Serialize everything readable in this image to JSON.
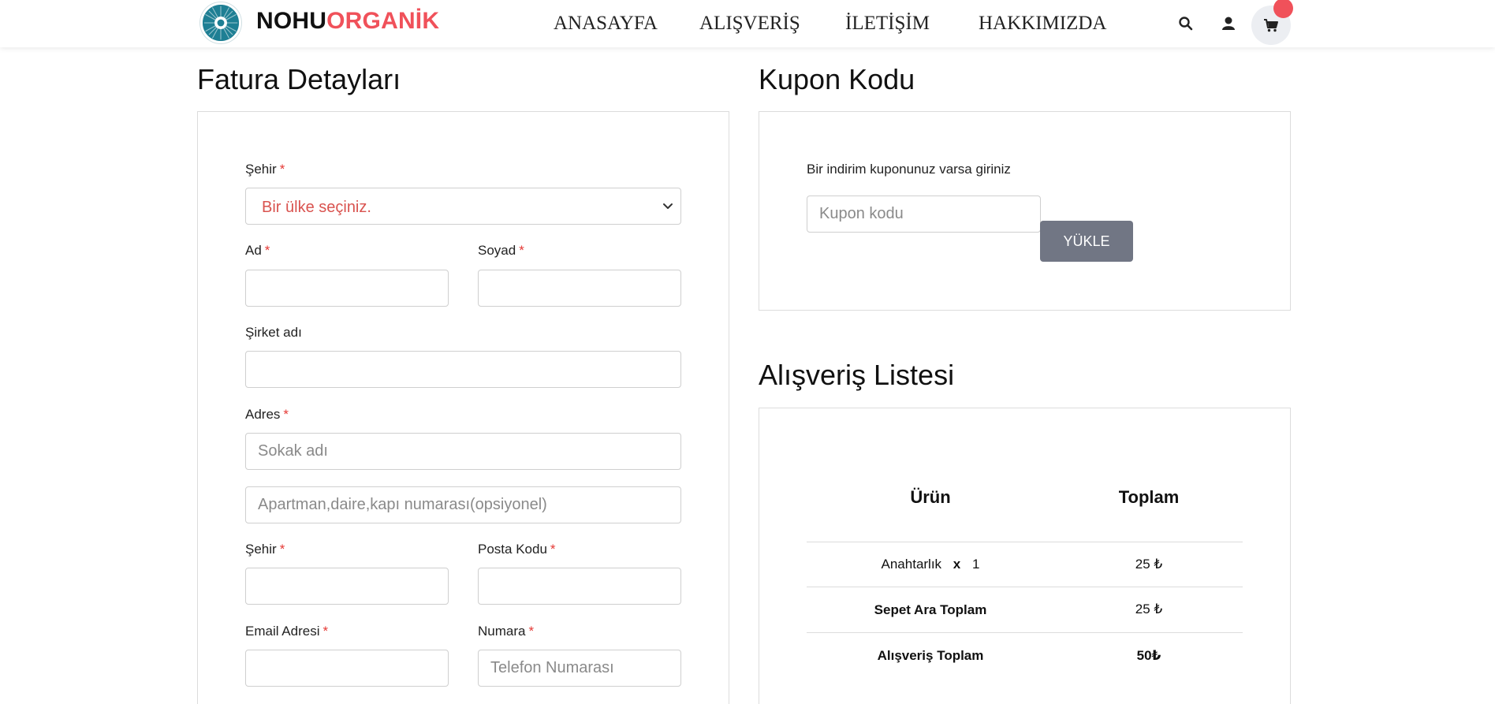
{
  "header": {
    "brand_part1": "NOHU",
    "brand_part2": "ORGANİK",
    "nav": [
      "ANASAYFA",
      "ALIŞVERİŞ",
      "İLETİŞİM",
      "HAKKIMIZDA"
    ],
    "icons": [
      "search-icon",
      "user-icon",
      "cart-icon"
    ],
    "brand_colors": {
      "dark": "#111111",
      "accent": "#f0515a"
    }
  },
  "billing": {
    "title": "Fatura Detayları",
    "required_mark": "*",
    "country_label": "Şehir",
    "country_selected": "Bir ülke seçiniz.",
    "first_name_label": "Ad",
    "last_name_label": "Soyad",
    "company_label": "Şirket adı",
    "address_label": "Adres",
    "street_placeholder": "Sokak adı",
    "apartment_placeholder": "Apartman,daire,kapı numarası(opsiyonel)",
    "city_label": "Şehir",
    "postal_label": "Posta Kodu",
    "email_label": "Email Adresi",
    "phone_label": "Numara",
    "phone_placeholder": "Telefon Numarası"
  },
  "coupon": {
    "title": "Kupon Kodu",
    "description": "Bir indirim kuponunuz varsa giriniz",
    "placeholder": "Kupon kodu",
    "button_label": "YÜKLE"
  },
  "order": {
    "title": "Alışveriş Listesi",
    "headers": [
      "Ürün",
      "Toplam"
    ],
    "items": [
      {
        "name": "Anahtarlık",
        "times": "x",
        "qty": "1",
        "total": "25 ₺"
      }
    ],
    "subtotal_label": "Sepet Ara Toplam",
    "subtotal_value": "25 ₺",
    "grand_total_label": "Alışveriş Toplam",
    "grand_total_value": "50₺"
  }
}
